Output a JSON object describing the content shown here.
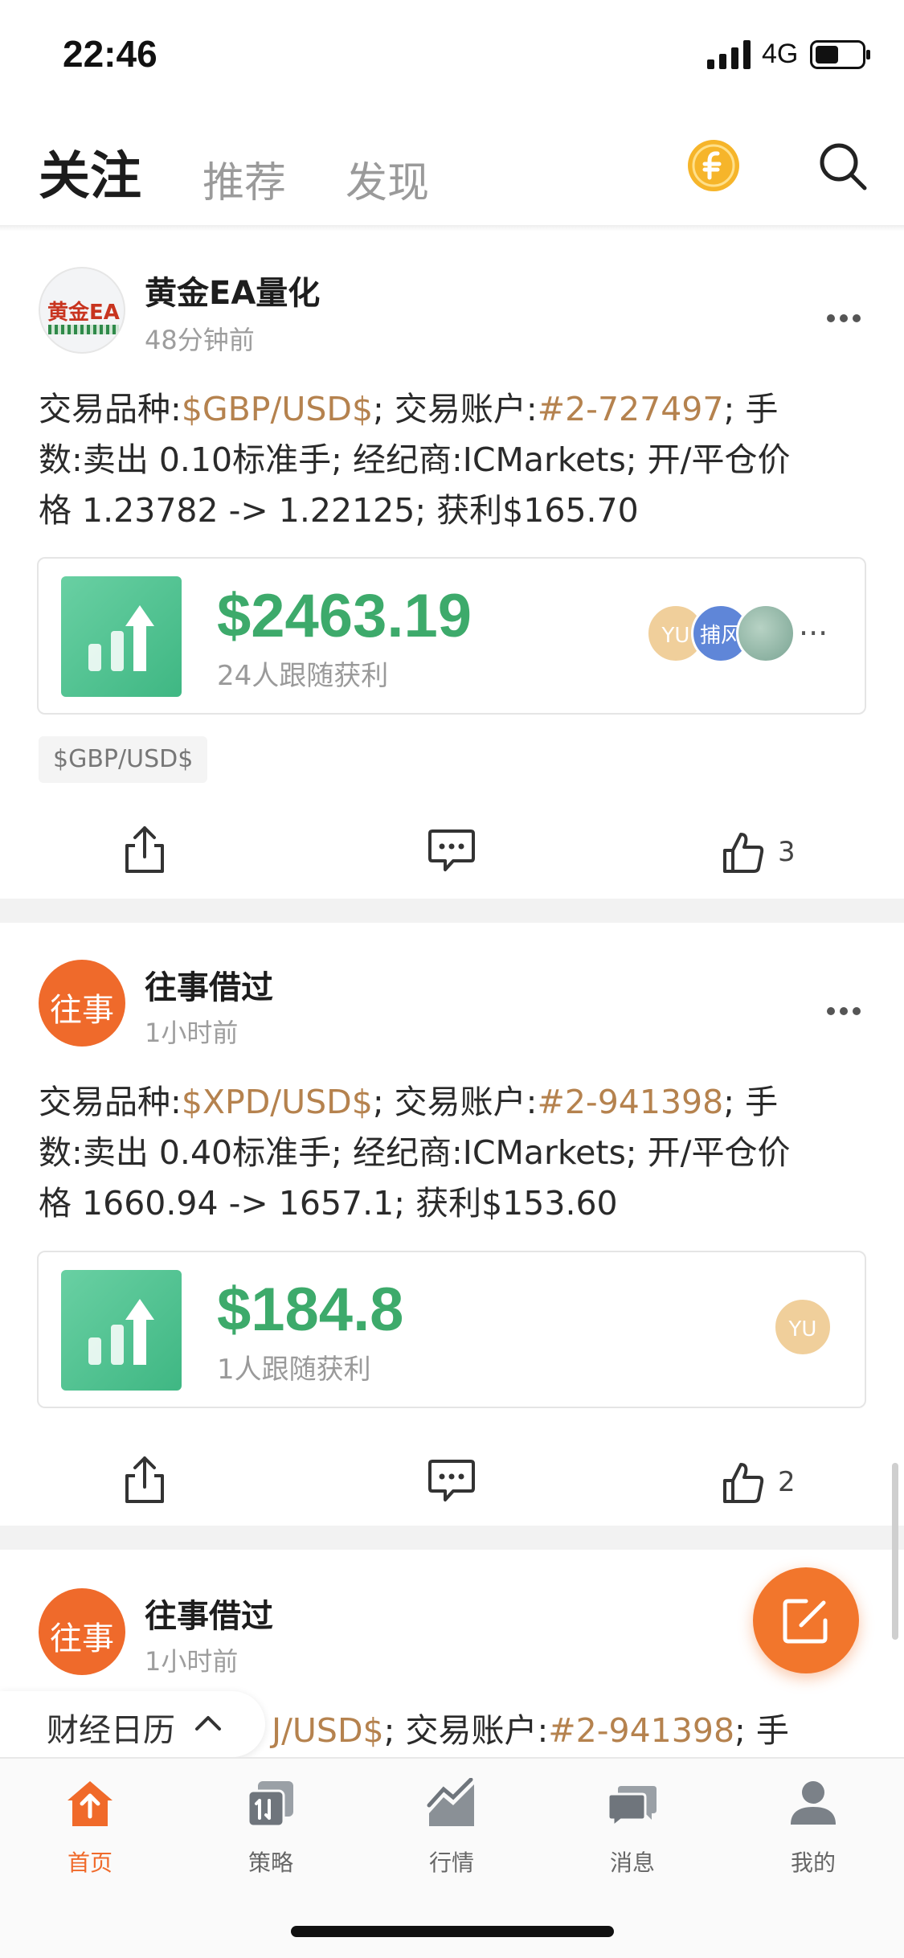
{
  "status_bar": {
    "time": "22:46",
    "network": "4G"
  },
  "nav": {
    "tabs": [
      {
        "label": "关注",
        "active": true
      },
      {
        "label": "推荐",
        "active": false
      },
      {
        "label": "发现",
        "active": false
      }
    ],
    "coin_icon": "coin-icon",
    "search_icon": "search-icon"
  },
  "posts": [
    {
      "author": "黄金EA量化",
      "avatar_text": "黄金EA",
      "time": "48分钟前",
      "body": {
        "l1_pre": "交易品种:",
        "l1_symbol": "$GBP/USD$",
        "l1_mid": "; 交易账户:",
        "l1_account": "#2-727497",
        "l1_post": "; 手",
        "l2": "数:卖出 0.10标准手; 经纪商:ICMarkets; 开/平仓价",
        "l3": "格 1.23782 -> 1.22125; 获利$165.70"
      },
      "profit": "$2463.19",
      "followers_caption": "24人跟随获利",
      "followers": [
        "YU",
        "捕风",
        ""
      ],
      "followers_more": "...",
      "tag": "$GBP/USD$",
      "likes": "3"
    },
    {
      "author": "往事借过",
      "avatar_text": "往事",
      "time": "1小时前",
      "body": {
        "l1_pre": "交易品种:",
        "l1_symbol": "$XPD/USD$",
        "l1_mid": "; 交易账户:",
        "l1_account": "#2-941398",
        "l1_post": "; 手",
        "l2": "数:卖出 0.40标准手; 经纪商:ICMarkets; 开/平仓价",
        "l3": "格 1660.94 -> 1657.1; 获利$153.60"
      },
      "profit": "$184.8",
      "followers_caption": "1人跟随获利",
      "followers": [
        "YU"
      ],
      "likes": "2"
    },
    {
      "author": "往事借过",
      "avatar_text": "往事",
      "time": "1小时前",
      "body_partial_symbol": "J/USD$",
      "body_partial_mid": "; 交易账户:",
      "body_partial_account": "#2-941398",
      "body_partial_post": "; 手"
    }
  ],
  "calendar": {
    "label": "财经日历"
  },
  "tab_bar": [
    {
      "label": "首页",
      "icon": "home-icon",
      "active": true
    },
    {
      "label": "策略",
      "icon": "strategy-icon",
      "active": false
    },
    {
      "label": "行情",
      "icon": "market-icon",
      "active": false
    },
    {
      "label": "消息",
      "icon": "message-icon",
      "active": false
    },
    {
      "label": "我的",
      "icon": "profile-icon",
      "active": false
    }
  ],
  "colors": {
    "accent": "#f06a2a",
    "profit_green": "#3daa6b",
    "highlight": "#b5824e"
  }
}
